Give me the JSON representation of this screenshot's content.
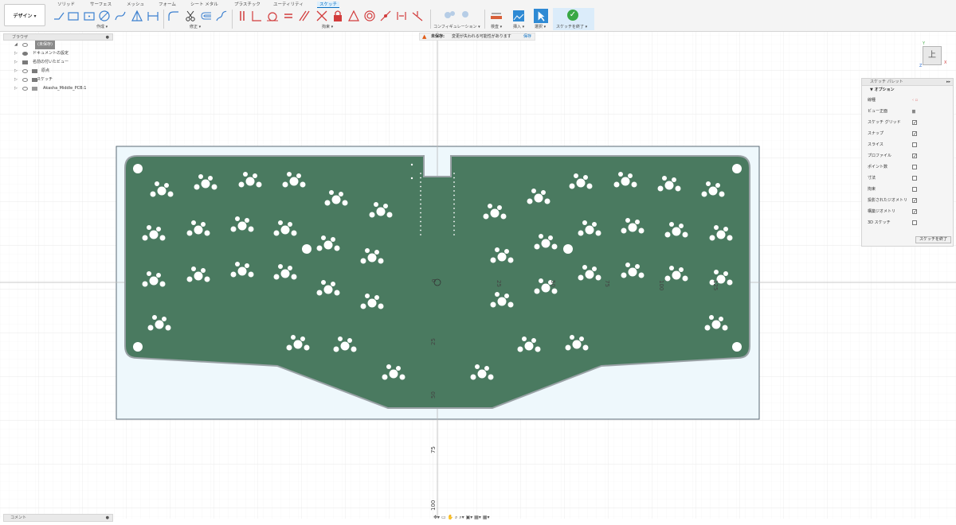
{
  "workspace": {
    "label": "デザイン ▾"
  },
  "tabs": [
    {
      "label": "ソリッド",
      "active": false
    },
    {
      "label": "サーフェス",
      "active": false
    },
    {
      "label": "メッシュ",
      "active": false
    },
    {
      "label": "フォーム",
      "active": false
    },
    {
      "label": "シート メタル",
      "active": false
    },
    {
      "label": "プラスチック",
      "active": false
    },
    {
      "label": "ユーティリティ",
      "active": false
    },
    {
      "label": "スケッチ",
      "active": true
    }
  ],
  "groups": {
    "create": "作成 ▾",
    "modify": "修正 ▾",
    "constraints": "拘束 ▾",
    "configure": "コンフィギュレーション ▾",
    "inspect": "検査 ▾",
    "insert": "挿入 ▾",
    "select": "選択 ▾",
    "finish": "スケッチを終了 ▾"
  },
  "browser": {
    "title": "ブラウザ",
    "items": [
      {
        "label": "(未保存)",
        "type": "root"
      },
      {
        "label": "ドキュメントの設定",
        "type": "settings"
      },
      {
        "label": "名前の付いたビュー",
        "type": "folder"
      },
      {
        "label": "原点",
        "type": "folder"
      },
      {
        "label": "スケッチ",
        "type": "folder"
      },
      {
        "label": "Akasha_Middle_PCB:1",
        "type": "component"
      }
    ]
  },
  "unsaved": {
    "label": "未保存:",
    "message": "変更が失われる可能性があります",
    "save": "保存"
  },
  "viewcube": {
    "face": "上",
    "axis_x": "X",
    "axis_y": "Y",
    "axis_z": "Z"
  },
  "palette": {
    "title": "スケッチ パレット",
    "section": "▼ オプション",
    "options": [
      {
        "label": "線種",
        "type": "icons"
      },
      {
        "label": "ビュー正面",
        "type": "icon"
      },
      {
        "label": "スケッチ グリッド",
        "checked": true
      },
      {
        "label": "スナップ",
        "checked": true
      },
      {
        "label": "スライス",
        "checked": false
      },
      {
        "label": "プロファイル",
        "checked": true
      },
      {
        "label": "ポイント数",
        "checked": false
      },
      {
        "label": "寸法",
        "checked": false
      },
      {
        "label": "拘束",
        "checked": false
      },
      {
        "label": "投影されたジオメトリ",
        "checked": true
      },
      {
        "label": "構築ジオメトリ",
        "checked": true
      },
      {
        "label": "3D スケッチ",
        "checked": false
      }
    ],
    "finish": "スケッチを終了"
  },
  "rulers": {
    "vertical": [
      "25",
      "50",
      "75",
      "100"
    ],
    "horizontal": [
      "25",
      "50",
      "75",
      "100",
      "125"
    ],
    "origin": "0"
  },
  "colors": {
    "pcb": "#4a7a60",
    "pcb_edge": "#9aa2a6",
    "board_bg": "#eef8fc",
    "accent": "#0a6fc2",
    "finish_green": "#39a845"
  },
  "comments": {
    "label": "コメント"
  }
}
